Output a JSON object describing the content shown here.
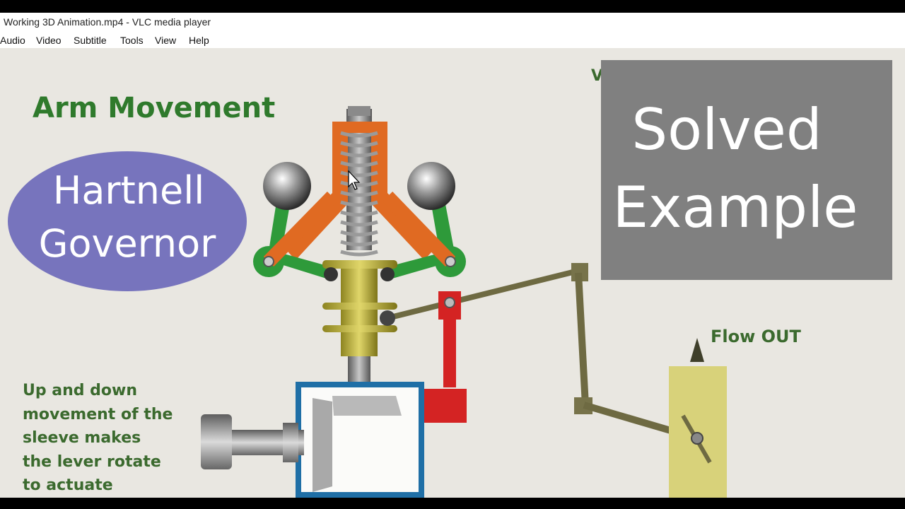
{
  "window": {
    "title": "Working 3D Animation.mp4 - VLC media player"
  },
  "menu": {
    "items": [
      "Audio",
      "Video",
      "Subtitle",
      "Tools",
      "View",
      "Help"
    ]
  },
  "video": {
    "heading": "Arm Movement",
    "badge_line1": "Hartnell",
    "badge_line2": "Governor",
    "overlay_line1": "Solved",
    "overlay_line2": "Example",
    "overlay_partial_letter": "V",
    "flow_label": "Flow OUT",
    "caption_lines": [
      "Up and down",
      "movement of the",
      "sleeve makes",
      "the lever rotate",
      "to actuate"
    ],
    "colors": {
      "badge": "#7774bd",
      "overlay": "#808080",
      "heading": "#2f7a2c",
      "frame_orange": "#e06a22",
      "arm_green": "#2e9a3a",
      "block_red": "#d42323",
      "box_blue": "#1f6fa6",
      "pipe_yellow": "#d8d27a"
    }
  }
}
